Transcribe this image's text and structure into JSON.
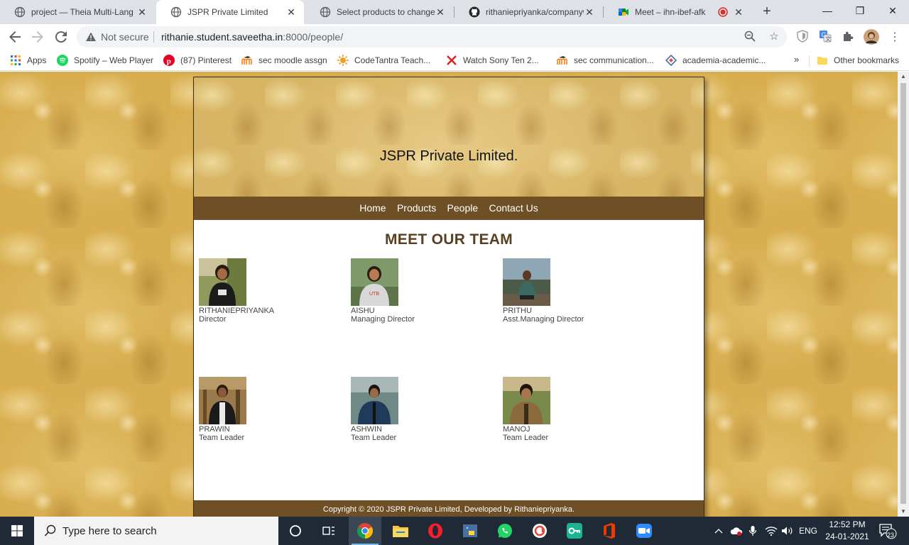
{
  "browser": {
    "tabs": [
      {
        "title": "project — Theia Multi-Lang",
        "icon": "globe-icon"
      },
      {
        "title": "JSPR Private Limited",
        "icon": "globe-icon",
        "active": true
      },
      {
        "title": "Select products to change | ",
        "icon": "globe-icon"
      },
      {
        "title": "rithaniepriyanka/companyw",
        "icon": "github-icon"
      },
      {
        "title": "Meet – ihn-ibef-afk",
        "icon": "google-meet-icon",
        "recording": true
      }
    ],
    "address": {
      "security": "Not secure",
      "host": "rithanie.student.saveetha.in",
      "path": ":8000/people/"
    },
    "bookmarks": [
      {
        "label": "Apps",
        "icon": "apps-grid-icon"
      },
      {
        "label": "Spotify – Web Player",
        "icon": "spotify-icon"
      },
      {
        "label": "(87) Pinterest",
        "icon": "pinterest-icon"
      },
      {
        "label": "sec moodle assgn",
        "icon": "moodle-icon"
      },
      {
        "label": "CodeTantra Teach...",
        "icon": "codetantra-icon"
      },
      {
        "label": "Watch Sony Ten 2...",
        "icon": "sony-ten-icon"
      },
      {
        "label": "sec communication...",
        "icon": "moodle-icon"
      },
      {
        "label": "academia-academic...",
        "icon": "academia-icon"
      }
    ],
    "other_bookmarks": "Other bookmarks",
    "overflow": "»"
  },
  "site": {
    "title": "JSPR Private Limited.",
    "nav": [
      "Home",
      "Products",
      "People",
      "Contact Us"
    ],
    "team_heading": "MEET OUR TEAM",
    "members": [
      {
        "name": "RITHANIEPRIYANKA",
        "role": "Director"
      },
      {
        "name": "AISHU",
        "role": "Managing Director"
      },
      {
        "name": "PRITHU",
        "role": "Asst.Managing Director"
      },
      {
        "name": "PRAWIN",
        "role": "Team Leader"
      },
      {
        "name": "ASHWIN",
        "role": "Team Leader"
      },
      {
        "name": "MANOJ",
        "role": "Team Leader"
      }
    ],
    "footer": "Copyright © 2020 JSPR Private Limited, Developed by Rithaniepriyanka."
  },
  "taskbar": {
    "search_placeholder": "Type here to search",
    "apps": [
      "task-view-icon",
      "chrome-icon",
      "file-explorer-icon",
      "opera-icon",
      "python-icon",
      "whatsapp-icon",
      "anydesk-icon",
      "vpn-key-icon",
      "office-icon",
      "zoom-icon"
    ],
    "lang": "ENG",
    "time": "12:52 PM",
    "date": "24-01-2021",
    "notifications": "23"
  }
}
